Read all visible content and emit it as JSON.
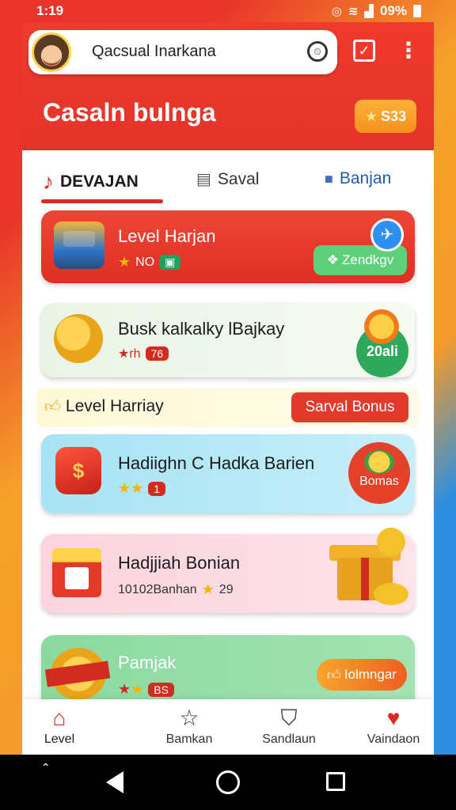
{
  "status_bar": {
    "time": "1:19",
    "battery": "09%",
    "icons": [
      "alarm-icon",
      "wifi-icon",
      "signal-icon",
      "battery-icon"
    ]
  },
  "header": {
    "search_text": "Qacsual Inarkana",
    "title": "Casaln bulnga",
    "coin_badge": "S33",
    "accent": "#e8342a"
  },
  "tabs": [
    {
      "label": "DEVAJAN",
      "icon": "music-note-icon",
      "active": true
    },
    {
      "label": "Saval",
      "icon": "clipboard-icon",
      "active": false
    },
    {
      "label": "Banjan",
      "icon": "bag-icon",
      "active": false
    }
  ],
  "cards": [
    {
      "title": "Level Harjan",
      "badge_text": "NO",
      "action": "Zendkgv",
      "bg": "#e8342a"
    },
    {
      "title": "Busk kalkalky lBajkay",
      "badge_prefix": "★rh",
      "badge_value": "76",
      "action": "20ali",
      "bg": "#eaf4e6"
    },
    {
      "title": "Hadiighn C Hadka Barien",
      "badge_value": "1",
      "action": "Bomas",
      "bg": "#a8e3f4"
    },
    {
      "title": "Hadjjiah Bonian",
      "badge_prefix": "10102Banhan",
      "badge_value": "29",
      "bg": "#fbd4de"
    },
    {
      "title": "Pamjak",
      "badge_value": "BS",
      "action": "Iolmngar",
      "bg": "#8ad9a0"
    }
  ],
  "banner": {
    "left_text": "Level Harriay",
    "button": "Sarval Bonus"
  },
  "bottom_nav": [
    {
      "label": "Level",
      "icon": "home-icon",
      "active": true
    },
    {
      "label": "Bamkan",
      "icon": "star-outline-icon",
      "active": false
    },
    {
      "label": "Sandlaun",
      "icon": "trophy-icon",
      "active": false
    },
    {
      "label": "Vaindaon",
      "icon": "heart-icon",
      "active": false
    }
  ]
}
